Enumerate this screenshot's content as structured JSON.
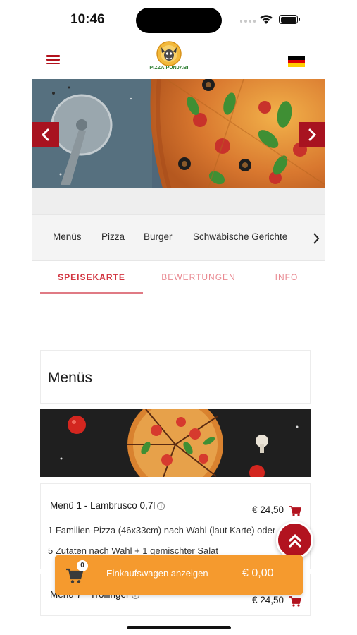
{
  "status_bar": {
    "time": "10:46"
  },
  "header": {
    "logo_text": "PIZZA PUNJABI",
    "flag": [
      "#000000",
      "#dd0000",
      "#ffce00"
    ]
  },
  "hero": {
    "prev_icon": "chevron-left-icon",
    "next_icon": "chevron-right-icon"
  },
  "categories": [
    "Menüs",
    "Pizza",
    "Burger",
    "Schwäbische Gerichte"
  ],
  "tabs": {
    "menu": "SPEISEKARTE",
    "reviews": "BEWERTUNGEN",
    "info": "INFO"
  },
  "section": {
    "title": "Menüs"
  },
  "items": [
    {
      "name": "Menü 1 - Lambrusco 0,7l",
      "price": "€ 24,50",
      "desc_line1": "1 Familien-Pizza (46x33cm) nach Wahl (laut Karte) oder",
      "desc_line2": "5 Zutaten nach Wahl + 1 gemischter Salat"
    },
    {
      "name": "Menü 7 - Trollinger",
      "price": "€ 24,50"
    }
  ],
  "cart": {
    "count": "0",
    "label": "Einkaufswagen anzeigen",
    "total": "€ 0,00"
  },
  "colors": {
    "brand_red": "#b2131f",
    "accent_orange": "#f59a2e",
    "tab_active": "#d2343f"
  }
}
